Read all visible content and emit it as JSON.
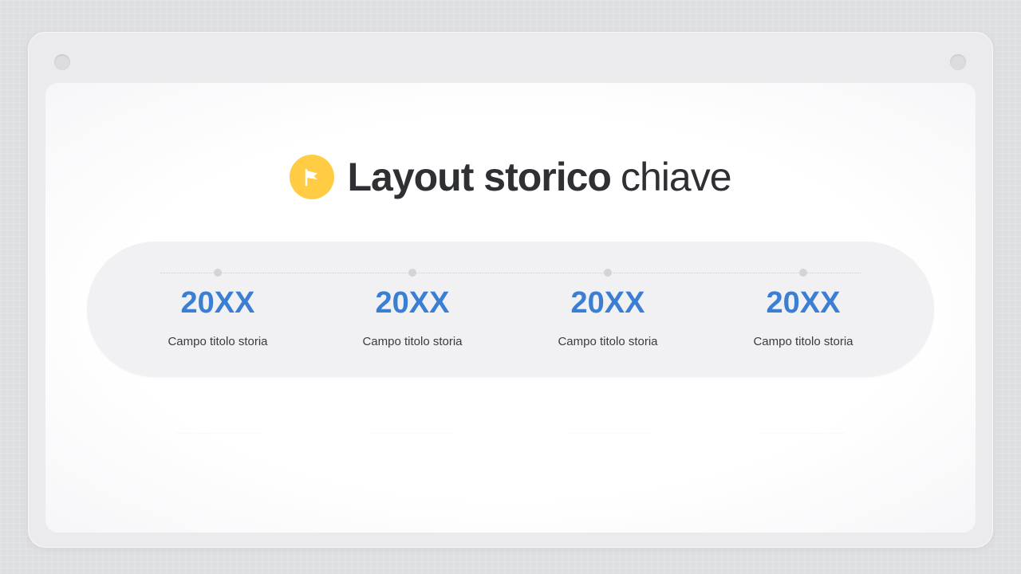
{
  "slide": {
    "title_bold": "Layout storico",
    "title_light": "chiave",
    "icon": "flag-icon",
    "accent_color": "#ffcc44",
    "year_color": "#3b7fd4"
  },
  "timeline": {
    "events": [
      {
        "year": "20XX",
        "label": "Campo titolo storia"
      },
      {
        "year": "20XX",
        "label": "Campo titolo storia"
      },
      {
        "year": "20XX",
        "label": "Campo titolo storia"
      },
      {
        "year": "20XX",
        "label": "Campo titolo storia"
      }
    ]
  }
}
